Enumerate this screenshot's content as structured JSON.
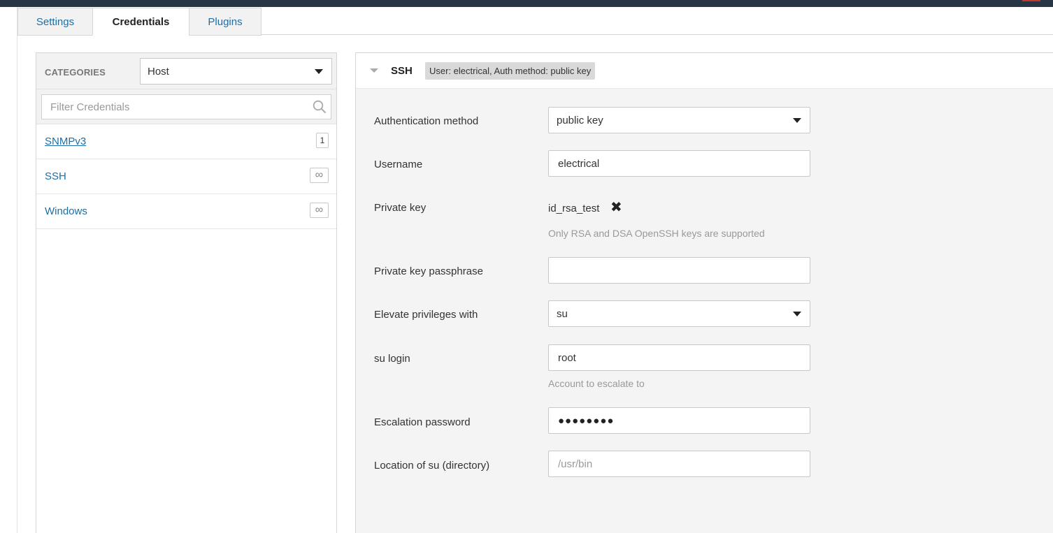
{
  "tabs": [
    {
      "label": "Settings",
      "active": false
    },
    {
      "label": "Credentials",
      "active": true
    },
    {
      "label": "Plugins",
      "active": false
    }
  ],
  "sidebar": {
    "categories_label": "CATEGORIES",
    "category_value": "Host",
    "filter_placeholder": "Filter Credentials",
    "items": [
      {
        "label": "SNMPv3",
        "badge": "1",
        "underlined": true
      },
      {
        "label": "SSH",
        "badge": "∞"
      },
      {
        "label": "Windows",
        "badge": "∞"
      }
    ]
  },
  "ssh": {
    "title": "SSH",
    "summary": "User: electrical, Auth method: public key",
    "fields": {
      "auth_method": {
        "label": "Authentication method",
        "value": "public key"
      },
      "username": {
        "label": "Username",
        "value": "electrical"
      },
      "private_key": {
        "label": "Private key",
        "value": "id_rsa_test",
        "help": "Only RSA and DSA OpenSSH keys are supported"
      },
      "passphrase": {
        "label": "Private key passphrase",
        "value": ""
      },
      "elevate": {
        "label": "Elevate privileges with",
        "value": "su"
      },
      "su_login": {
        "label": "su login",
        "value": "root",
        "help": "Account to escalate to"
      },
      "escalation_password": {
        "label": "Escalation password",
        "value": "●●●●●●●●"
      },
      "su_location": {
        "label": "Location of su (directory)",
        "placeholder": "/usr/bin"
      }
    }
  },
  "colors": {
    "topbar": "#263645",
    "link": "#1a6fa8",
    "panel_bg": "#f4f4f4"
  }
}
